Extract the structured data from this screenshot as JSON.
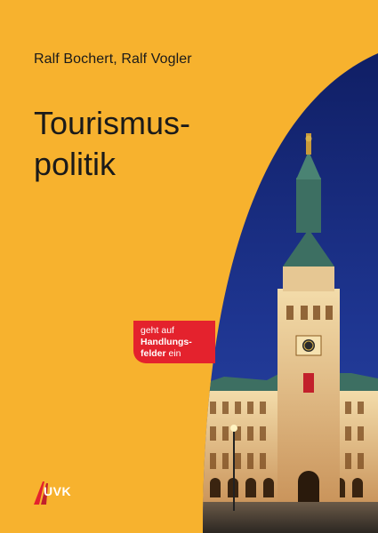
{
  "cover": {
    "authors": "Ralf Bochert, Ralf Vogler",
    "title_line1": "Tourismus-",
    "title_line2": "politik",
    "badge": {
      "line1": "geht auf",
      "line2": "Handlungs-",
      "line3_bold": "felder",
      "line3_rest": " ein"
    },
    "publisher": "UVK",
    "colors": {
      "background": "#f7b22e",
      "badge": "#e4222d",
      "sky": "#1a2a7a",
      "facade": "#e9cfa1"
    },
    "image": "hamburg-city-hall-night-photo"
  }
}
